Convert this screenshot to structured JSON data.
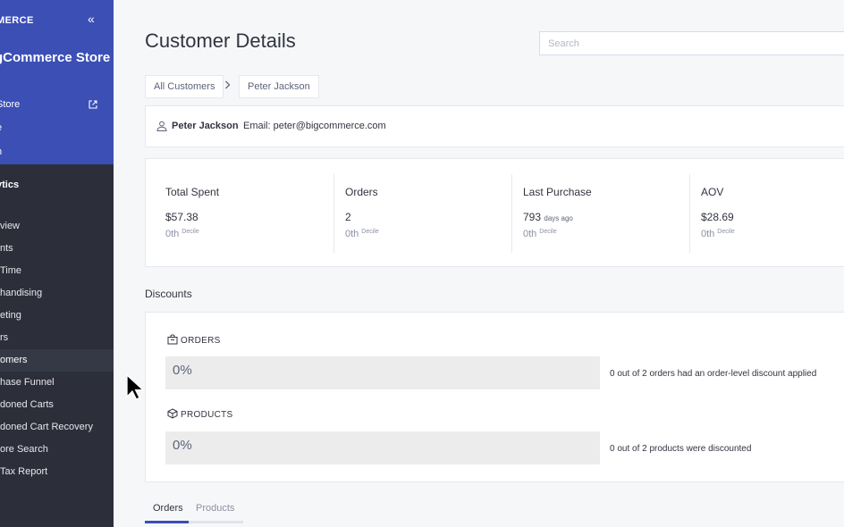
{
  "sidebar": {
    "brand": "MERCE",
    "collapse_icon": "double-chevron-left-icon",
    "store_name": "gCommerce Store",
    "store_sub": "/",
    "top_items": [
      "Store",
      "e",
      "h"
    ],
    "section": "ytics",
    "items": [
      {
        "label": "view",
        "active": false
      },
      {
        "label": "nts",
        "active": false
      },
      {
        "label": "Time",
        "active": false
      },
      {
        "label": "handising",
        "active": false
      },
      {
        "label": "eting",
        "active": false
      },
      {
        "label": "rs",
        "active": false
      },
      {
        "label": "omers",
        "active": true
      },
      {
        "label": "hase Funnel",
        "active": false
      },
      {
        "label": "doned Carts",
        "active": false
      },
      {
        "label": "doned Cart Recovery",
        "active": false
      },
      {
        "label": "ore Search",
        "active": false
      },
      {
        "label": " Tax Report",
        "active": false
      }
    ]
  },
  "header": {
    "title": "Customer Details",
    "search_placeholder": "Search"
  },
  "breadcrumb": {
    "items": [
      "All Customers",
      "Peter Jackson"
    ],
    "separator": ">"
  },
  "customer": {
    "name": "Peter Jackson",
    "email": "Email: peter@bigcommerce.com"
  },
  "stats": [
    {
      "label": "Total Spent",
      "value": "$57.38",
      "suffix": "",
      "decile": "0th",
      "decile_label": "Decile"
    },
    {
      "label": "Orders",
      "value": "2",
      "suffix": "",
      "decile": "0th",
      "decile_label": "Decile"
    },
    {
      "label": "Last Purchase",
      "value": "793",
      "suffix": "days ago",
      "decile": "0th",
      "decile_label": "Decile"
    },
    {
      "label": "AOV",
      "value": "$28.69",
      "suffix": "",
      "decile": "0th",
      "decile_label": "Decile"
    }
  ],
  "discounts": {
    "title": "Discounts",
    "orders": {
      "heading": "ORDERS",
      "percent": "0%",
      "fraction": 0,
      "note": "0 out of 2 orders had an order-level discount applied"
    },
    "products": {
      "heading": "PRODUCTS",
      "percent": "0%",
      "fraction": 0,
      "note": "0 out of 2 products were discounted"
    }
  },
  "tabs": [
    {
      "label": "Orders",
      "active": true
    },
    {
      "label": "Products",
      "active": false
    }
  ],
  "colors": {
    "accent": "#3b4fb5",
    "sidebar_bg": "#2c2f3a",
    "bar_bg": "#ececec"
  }
}
